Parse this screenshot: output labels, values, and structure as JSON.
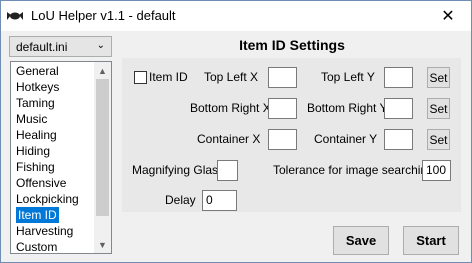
{
  "window": {
    "title": "LoU Helper v1.1 - default",
    "close_glyph": "✕",
    "minimize_glyph": "—"
  },
  "config": {
    "selected": "default.ini"
  },
  "sidebar": {
    "items": [
      {
        "label": "General"
      },
      {
        "label": "Hotkeys"
      },
      {
        "label": "Taming"
      },
      {
        "label": "Music"
      },
      {
        "label": "Healing"
      },
      {
        "label": "Hiding"
      },
      {
        "label": "Fishing"
      },
      {
        "label": "Offensive"
      },
      {
        "label": "Lockpicking"
      },
      {
        "label": "Item ID",
        "selected": true
      },
      {
        "label": "Harvesting"
      },
      {
        "label": "Custom"
      }
    ],
    "scroll_up_glyph": "▲",
    "scroll_down_glyph": "▼"
  },
  "panel": {
    "title": "Item ID Settings",
    "item_id_checkbox": {
      "label": "Item ID",
      "checked": false
    },
    "top_left_x": {
      "label": "Top Left X",
      "value": ""
    },
    "top_left_y": {
      "label": "Top Left Y",
      "value": ""
    },
    "bottom_right_x": {
      "label": "Bottom Right X",
      "value": ""
    },
    "bottom_right_y": {
      "label": "Bottom Right Y",
      "value": ""
    },
    "container_x": {
      "label": "Container X",
      "value": ""
    },
    "container_y": {
      "label": "Container Y",
      "value": ""
    },
    "set_label": "Set",
    "magnifying_glass": {
      "label": "Magnifying Glass",
      "value": ""
    },
    "tolerance": {
      "label": "Tolerance for image searching",
      "value": "100"
    },
    "delay": {
      "label": "Delay",
      "value": "0"
    }
  },
  "footer": {
    "save_label": "Save",
    "start_label": "Start"
  }
}
